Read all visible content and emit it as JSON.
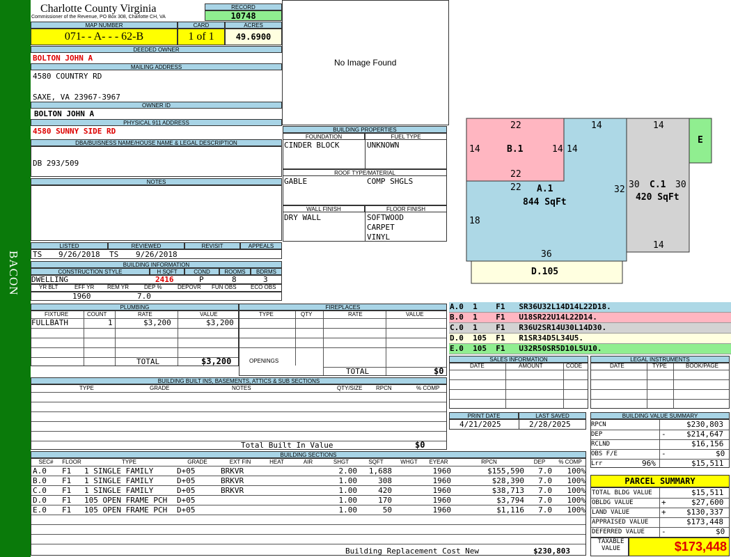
{
  "sidebar": {
    "label": "BACON"
  },
  "county": {
    "name": "Charlotte County Virginia",
    "address": "Commissioner of the Revenue, PO Box 308, Charlotte CH, VA"
  },
  "record": {
    "label": "RECORD",
    "value": "10748"
  },
  "map": {
    "label": "MAP NUMBER",
    "value": "071- - A- - - 62-B"
  },
  "card": {
    "label": "CARD",
    "value": "1 of 1"
  },
  "acres": {
    "label": "ACRES",
    "value": "49.6900"
  },
  "deeded": {
    "label": "DEEDED OWNER",
    "value": "BOLTON JOHN A"
  },
  "mailing": {
    "label": "MAILING ADDRESS",
    "line1": "4580 COUNTRY RD",
    "line2": "SAXE, VA 23967-3967"
  },
  "owner_id": {
    "label": "OWNER ID",
    "value": "BOLTON JOHN A"
  },
  "physical": {
    "label": "PHYSICAL 911 ADDRESS",
    "value": "4580 SUNNY SIDE RD"
  },
  "dba": {
    "label": "DBA/BUISNESS NAME/HOUSE NAME & LEGAL DESCRIPTION",
    "value": "DB 293/509"
  },
  "notes": {
    "label": "NOTES"
  },
  "image": {
    "text": "No Image Found"
  },
  "props": {
    "header": "BUILDING PROPERTIES",
    "foundation_label": "FOUNDATION",
    "foundation": "CINDER BLOCK",
    "fuel_label": "FUEL TYPE",
    "fuel": "UNKNOWN",
    "roof_header": "ROOF TYPE/MATERIAL",
    "roof1": "GABLE",
    "roof2": "COMP SHGLS",
    "wall_label": "WALL FINISH",
    "wall": "DRY WALL",
    "floor_label": "FLOOR FINISH",
    "floor1": "SOFTWOOD",
    "floor2": "CARPET",
    "floor3": "VINYL"
  },
  "listed": {
    "listed_label": "LISTED",
    "reviewed_label": "REVIEWED",
    "revisit_label": "REVISIT",
    "appeals_label": "APPEALS",
    "listed_by": "TS",
    "listed_date": "9/26/2018",
    "reviewed_by": "TS",
    "reviewed_date": "9/26/2018"
  },
  "bldg": {
    "header": "BUILDING INFORMATION",
    "h_style": "CONSTRUCTION STYLE",
    "h_sqft": "H SQFT",
    "h_cond": "COND",
    "h_rooms": "ROOMS",
    "h_bdrms": "BDRMS",
    "style": "DWELLING",
    "sqft": "2416",
    "cond": "P",
    "rooms": "8",
    "bdrms": "3",
    "h_yrblt": "YR BLT",
    "h_effyr": "EFF YR",
    "h_remyr": "REM YR",
    "h_dep": "DEP %",
    "h_depovr": "DEPOVR",
    "h_funobs": "FUN OBS",
    "h_ecoobs": "ECO OBS",
    "effyr": "1960",
    "dep": "7.0"
  },
  "plumbing": {
    "header": "PLUMBING",
    "h_fixture": "FIXTURE",
    "h_count": "COUNT",
    "h_rate": "RATE",
    "h_value": "VALUE",
    "fixture": "FULLBATH",
    "count": "1",
    "rate": "$3,200",
    "value": "$3,200",
    "total_label": "TOTAL",
    "total": "$3,200"
  },
  "fireplaces": {
    "header": "FIREPLACES",
    "h_type": "TYPE",
    "h_qty": "QTY",
    "h_rate": "RATE",
    "h_value": "VALUE",
    "openings": "OPENINGS",
    "total_label": "TOTAL",
    "total": "$0"
  },
  "builtins": {
    "header": "BUILDING BUILT INS, BASEMENTS, ATTICS & SUB SECTIONS",
    "h_type": "TYPE",
    "h_grade": "GRADE",
    "h_notes": "NOTES",
    "h_qty": "QTY/SIZE",
    "h_rpcn": "RPCN",
    "h_pct": "% COMP",
    "total_label": "Total Built In Value",
    "total": "$0"
  },
  "sections": {
    "header": "BUILDING SECTIONS",
    "cols": [
      "SEC#",
      "FLOOR",
      "TYPE",
      "GRADE",
      "EXT FIN",
      "HEAT",
      "AIR",
      "SHGT",
      "SQFT",
      "WHGT",
      "EYEAR",
      "RPCN",
      "DEP",
      "% COMP"
    ],
    "rows": [
      [
        "A.0",
        "F1",
        "1 SINGLE FAMILY",
        "D+05",
        "BRKVR",
        "",
        "",
        "2.00",
        "1,688",
        "",
        "1960",
        "$155,590",
        "7.0",
        "100%"
      ],
      [
        "B.0",
        "F1",
        "1 SINGLE FAMILY",
        "D+05",
        "BRKVR",
        "",
        "",
        "1.00",
        "308",
        "",
        "1960",
        "$28,390",
        "7.0",
        "100%"
      ],
      [
        "C.0",
        "F1",
        "1 SINGLE FAMILY",
        "D+05",
        "BRKVR",
        "",
        "",
        "1.00",
        "420",
        "",
        "1960",
        "$38,713",
        "7.0",
        "100%"
      ],
      [
        "D.0",
        "F1",
        "105 OPEN FRAME PCH",
        "D+05",
        "",
        "",
        "",
        "1.00",
        "170",
        "",
        "1960",
        "$3,794",
        "7.0",
        "100%"
      ],
      [
        "E.0",
        "F1",
        "105 OPEN FRAME PCH",
        "D+05",
        "",
        "",
        "",
        "1.00",
        "50",
        "",
        "1960",
        "$1,116",
        "7.0",
        "100%"
      ]
    ],
    "brcn_label": "Building Replacement Cost New",
    "brcn": "$230,803"
  },
  "sketch": {
    "b_label": "B.1",
    "a_label": "A.1",
    "a_sqft": "844 SqFt",
    "c_label": "C.1",
    "c_sqft": "420 SqFt",
    "d_label": "D.105",
    "e_label": "E",
    "n22a": "22",
    "n22b": "22",
    "n22c": "22",
    "n14a": "14",
    "n14b": "14",
    "n14c": "14",
    "n14d": "14",
    "n14e": "14",
    "n14f": "14",
    "n32": "32",
    "n18": "18",
    "n36": "36",
    "n30a": "30",
    "n30b": "30"
  },
  "vectors": [
    {
      "text": "A.0  1    F1   SR36U32L14D14L22D18.",
      "color": "#add8e6"
    },
    {
      "text": "B.0  1    F1   U18SR22U14L22D14.",
      "color": "#ffb6c1"
    },
    {
      "text": "C.0  1    F1   R36U2SR14U30L14D30.",
      "color": "#d3d3d3"
    },
    {
      "text": "D.0  105  F1   R1SR34D5L34U5.",
      "color": "#ffffe0"
    },
    {
      "text": "E.0  105  F1   U32R50SR5D10L5U10.",
      "color": "#90ee90"
    }
  ],
  "sales": {
    "header": "SALES INFORMATION",
    "h_date": "DATE",
    "h_amount": "AMOUNT",
    "h_code": "CODE"
  },
  "legal": {
    "header": "LEGAL INSTRUMENTS",
    "h_date": "DATE",
    "h_type": "TYPE",
    "h_book": "BOOK/PAGE"
  },
  "print": {
    "print_label": "PRINT DATE",
    "saved_label": "LAST SAVED",
    "print_date": "4/21/2025",
    "saved_date": "2/28/2025"
  },
  "bvs": {
    "header": "BUILDING VALUE SUMMARY",
    "rpcn_label": "RPCN",
    "rpcn": "$230,803",
    "dep_label": "DEP",
    "dep_sign": "-",
    "dep": "$214,647",
    "rclnd_label": "RCLND",
    "rclnd": "$16,156",
    "obs_label": "OBS F/E",
    "obs_sign": "-",
    "obs": "$0",
    "lrr_label": "Lrr",
    "lrr_pct": "96%",
    "lrr": "$15,511"
  },
  "parcel": {
    "title": "PARCEL SUMMARY",
    "tbv_label": "TOTAL BLDG VALUE",
    "tbv": "$15,511",
    "obldg_label": "OBLDG VALUE",
    "obldg_sign": "+",
    "obldg": "$27,600",
    "land_label": "LAND VALUE",
    "land_sign": "+",
    "land": "$130,337",
    "appr_label": "APPRAISED VALUE",
    "appr": "$173,448",
    "def_label": "DEFERRED VALUE",
    "def_sign": "-",
    "def": "$0",
    "taxable_label": "TAXABLE VALUE",
    "taxable": "$173,448"
  }
}
